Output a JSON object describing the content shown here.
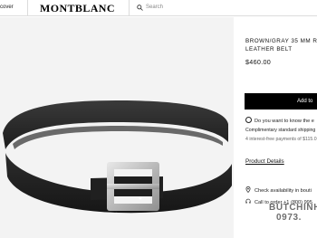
{
  "header": {
    "discover_label": "cover",
    "logo_text": "MONTBLANC",
    "search_placeholder": "Search",
    "search_icon": "search-icon"
  },
  "product": {
    "title_line1": "BROWN/GRAY 35 MM R",
    "title_line2": "LEATHER BELT",
    "price": "$460.00",
    "add_to_bag_label": "Add to",
    "know_when_text": "Do you want to know the e",
    "shipping_text": "Complimentary standard shipping",
    "installments_text": "4 interest-free payments of $115.0",
    "details_link": "Product Details",
    "check_availability": "Check availability in bouti",
    "call_to_order": "Call to order +1 (800) 995"
  },
  "watermark": {
    "line1": "BUTCHINH",
    "line2": "0973."
  },
  "colors": {
    "button_bg": "#000000",
    "image_bg": "#f3f3f3",
    "belt_leather": "#2a2a2a",
    "buckle_metal": "#c9c9c9"
  }
}
